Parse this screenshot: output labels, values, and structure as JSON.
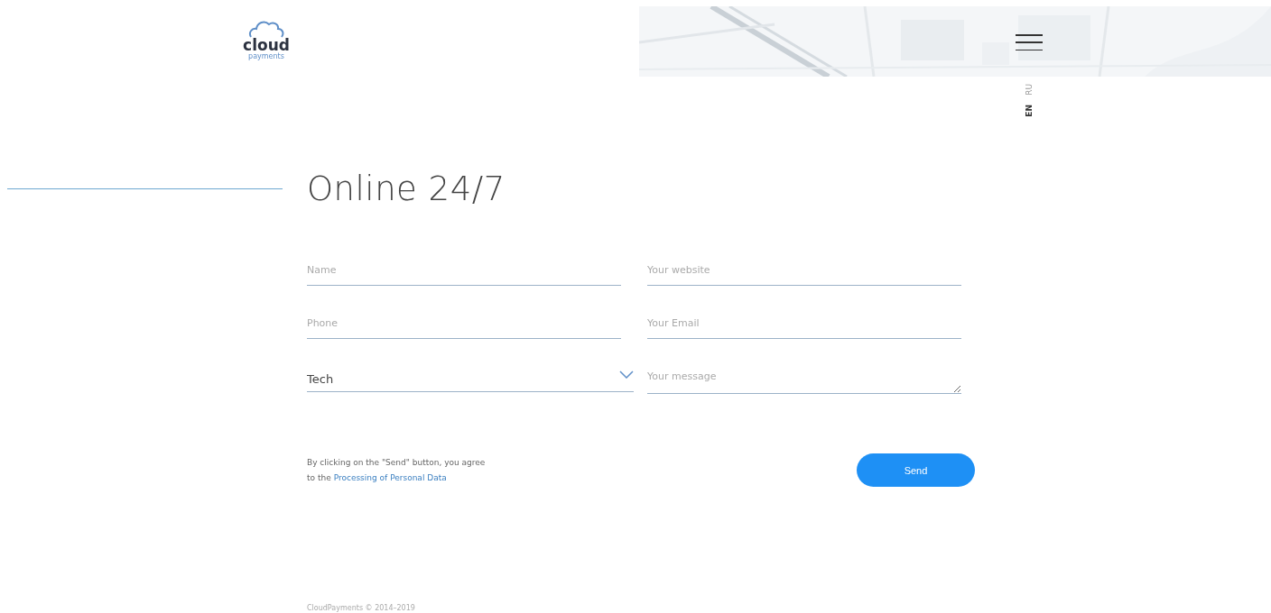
{
  "header": {
    "logo": {
      "word": "cloud",
      "sub": "payments"
    },
    "languages": [
      {
        "label": "RU",
        "selected": false
      },
      {
        "label": "EN",
        "selected": true
      }
    ]
  },
  "heading": "Online 24/7",
  "form": {
    "fields": [
      {
        "kind": "text",
        "placeholder": "Name"
      },
      {
        "kind": "text",
        "placeholder": "Your website"
      },
      {
        "kind": "text",
        "placeholder": "Phone"
      },
      {
        "kind": "text",
        "placeholder": "Your Email"
      },
      {
        "kind": "select",
        "value": "Tech"
      },
      {
        "kind": "textarea",
        "placeholder": "Your message"
      }
    ],
    "consent": "By clicking on the \"Send\" button, you agree",
    "consent_prefix": "to the",
    "consent_link": "Processing of Personal Data",
    "submit": "Send"
  },
  "footer": "CloudPayments © 2014–2019"
}
